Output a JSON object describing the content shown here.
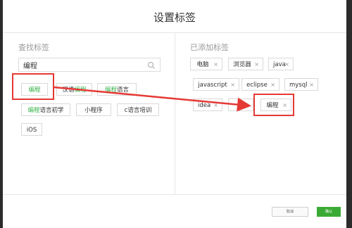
{
  "dialog": {
    "title": "设置标签"
  },
  "left": {
    "title": "查找标签",
    "search": {
      "value": "编程",
      "placeholder": ""
    },
    "results": [
      {
        "pre": "",
        "hl": "编程",
        "post": ""
      },
      {
        "pre": "汉语",
        "hl": "编程",
        "post": ""
      },
      {
        "pre": "",
        "hl": "编程",
        "post": "语言"
      },
      {
        "pre": "",
        "hl": "编程",
        "post": "语言初学"
      },
      {
        "pre": "小程序",
        "hl": "",
        "post": ""
      },
      {
        "pre": "c语言培训",
        "hl": "",
        "post": ""
      },
      {
        "pre": "iOS",
        "hl": "",
        "post": ""
      }
    ]
  },
  "right": {
    "title": "已添加标签",
    "tags": [
      {
        "label": "电脑",
        "remove": "×"
      },
      {
        "label": "浏览器",
        "remove": "×"
      },
      {
        "label": "java",
        "remove": "×"
      },
      {
        "label": "javascript",
        "remove": "×"
      },
      {
        "label": "eclipse",
        "remove": "×"
      },
      {
        "label": "mysql",
        "remove": "×"
      },
      {
        "label": "idea",
        "remove": "×"
      },
      {
        "label": "",
        "remove": "×"
      },
      {
        "label": "编程",
        "remove": "×"
      }
    ]
  },
  "footer": {
    "cancel_label": "取消",
    "ok_label": "确认"
  },
  "colors": {
    "highlight": "#35b24a",
    "annotation": "#e53935",
    "primary": "#3aaa35"
  }
}
